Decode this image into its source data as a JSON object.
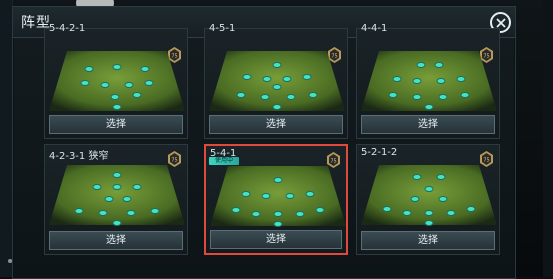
{
  "dialog": {
    "title": "阵型",
    "close_icon": "close-icon"
  },
  "colors": {
    "accent": "#3dd6c3",
    "selected_border": "#e04a3d",
    "player_dot": "#46e3c0",
    "pitch": "#5f8a2a"
  },
  "cards": [
    {
      "label": "5-4-2-1",
      "badge": "75",
      "button": "选择",
      "selected": false
    },
    {
      "label": "4-5-1",
      "badge": "75",
      "button": "选择",
      "selected": false
    },
    {
      "label": "4-4-1",
      "badge": "75",
      "button": "选择",
      "selected": false
    },
    {
      "label": "4-2-3-1 狭窄",
      "badge": "75",
      "button": "选择",
      "selected": false
    },
    {
      "label": "5-4-1",
      "badge": "75",
      "button": "选择",
      "selected": true,
      "tag": "使用中"
    },
    {
      "label": "5-2-1-2",
      "badge": "75",
      "button": "选择",
      "selected": false
    }
  ]
}
